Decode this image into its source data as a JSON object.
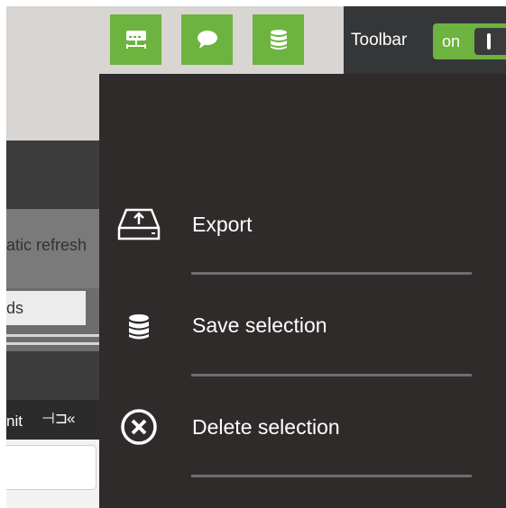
{
  "toolbar": {
    "buttons": [
      {
        "icon": "network-server-icon"
      },
      {
        "icon": "chat-bubble-icon"
      },
      {
        "icon": "database-icon"
      }
    ],
    "label": "Toolbar",
    "toggle": {
      "state_label": "on"
    }
  },
  "background_panel": {
    "refresh_label": "atic refresh",
    "field_label": "ds",
    "unit_label": "nit",
    "pin_glyph": "⊣⊐",
    "collapse_glyph": "«"
  },
  "menu": {
    "items": [
      {
        "label": "Export",
        "icon": "export-tray-icon"
      },
      {
        "label": "Save selection",
        "icon": "database-icon"
      },
      {
        "label": "Delete selection",
        "icon": "circle-x-icon"
      }
    ]
  },
  "colors": {
    "accent_green": "#6db33f",
    "overlay_bg": "#2f2b2a",
    "divider": "#6e6e6e"
  }
}
